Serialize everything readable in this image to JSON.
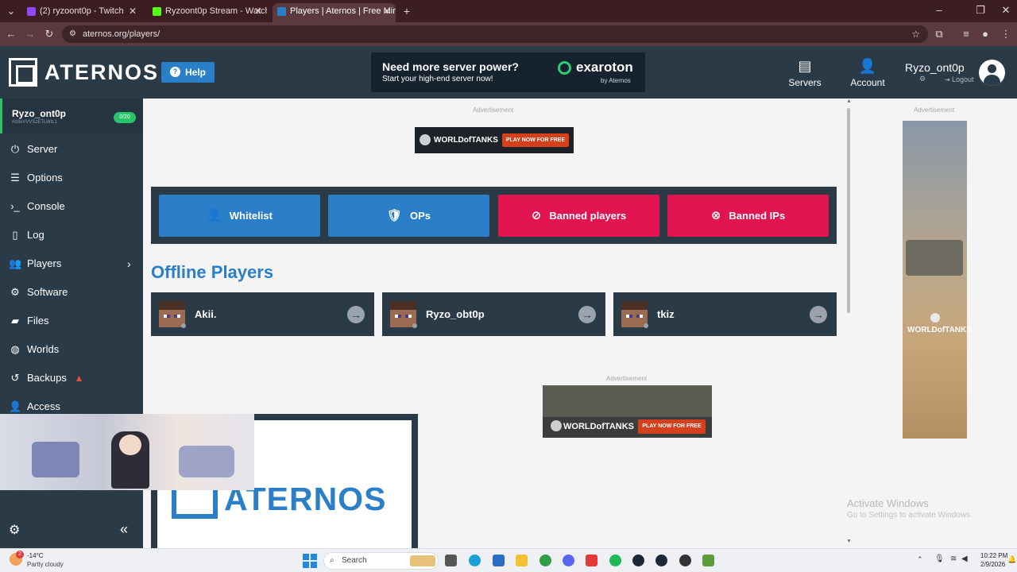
{
  "browser": {
    "tabs": [
      {
        "title": "(2) ryzoont0p - Twitch",
        "active": false
      },
      {
        "title": "Ryzoont0p Stream - Watch Live",
        "active": false
      },
      {
        "title": "Players | Aternos | Free Minecra",
        "active": true
      }
    ],
    "new_tab": "+",
    "url": "aternos.org/players/"
  },
  "header": {
    "logo": "ATERNOS",
    "help_label": "Help",
    "promo": {
      "headline": "Need more server power?",
      "subline": "Start your high-end server now!",
      "brand": "exaroton",
      "brand_sub": "by Aternos"
    },
    "servers_label": "Servers",
    "account_label": "Account",
    "username": "Ryzo_ont0p",
    "logout_label": "Logout"
  },
  "sidebar": {
    "server_name": "Ryzo_ont0p",
    "server_id": "#d3oVVVSzETLWIL1",
    "slot_badge": "0/20",
    "items": [
      {
        "label": "Server",
        "icon": "power-icon"
      },
      {
        "label": "Options",
        "icon": "sliders-icon"
      },
      {
        "label": "Console",
        "icon": "terminal-icon"
      },
      {
        "label": "Log",
        "icon": "file-icon"
      },
      {
        "label": "Players",
        "icon": "users-icon"
      },
      {
        "label": "Software",
        "icon": "cogs-icon"
      },
      {
        "label": "Files",
        "icon": "folder-icon"
      },
      {
        "label": "Worlds",
        "icon": "globe-icon"
      },
      {
        "label": "Backups",
        "icon": "backup-icon"
      },
      {
        "label": "Access",
        "icon": "user-plus-icon"
      }
    ],
    "collapse": "«"
  },
  "main": {
    "ad_label": "Advertisement",
    "wot_text": "WORLDofTANKS",
    "wot_cta": "PLAY NOW FOR FREE",
    "lists": [
      {
        "label": "Whitelist",
        "color": "#2b7ec8"
      },
      {
        "label": "OPs",
        "color": "#2b7ec8"
      },
      {
        "label": "Banned players",
        "color": "#e1144f"
      },
      {
        "label": "Banned IPs",
        "color": "#e1144f"
      }
    ],
    "offline_title": "Offline Players",
    "players": [
      {
        "name": "Akii."
      },
      {
        "name": "Ryzo_obt0p"
      },
      {
        "name": "tkiz"
      }
    ],
    "promo_logo": "ATERNOS"
  },
  "system": {
    "watermark_title": "Activate Windows",
    "watermark_sub": "Go to Settings to activate Windows.",
    "weather_temp": "-14°C",
    "weather_desc": "Partly cloudy",
    "weather_badge": "2",
    "search_label": "Search",
    "time": "10:22 PM",
    "date": "2/9/2026"
  }
}
